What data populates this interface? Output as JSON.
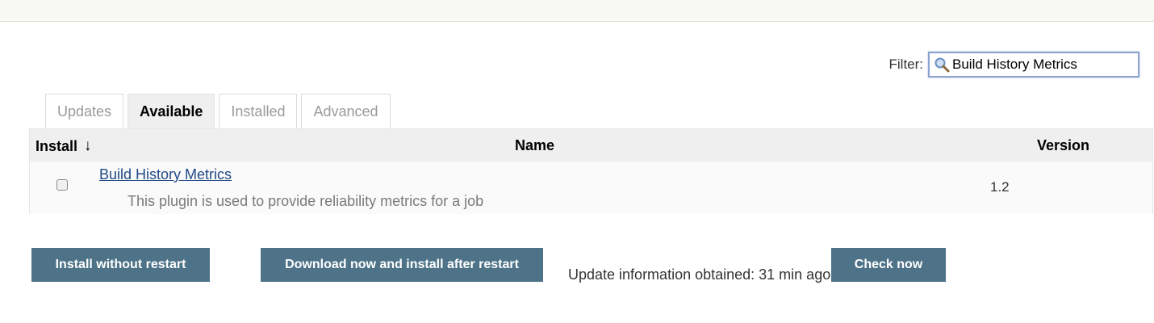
{
  "filter": {
    "label": "Filter:",
    "value": "Build History Metrics"
  },
  "tabs": [
    {
      "label": "Updates",
      "active": false
    },
    {
      "label": "Available",
      "active": true
    },
    {
      "label": "Installed",
      "active": false
    },
    {
      "label": "Advanced",
      "active": false
    }
  ],
  "table": {
    "columns": {
      "install": "Install",
      "sort_indicator": "↓",
      "name": "Name",
      "version": "Version"
    },
    "rows": [
      {
        "checked": false,
        "name": "Build History Metrics",
        "description": "This plugin is used to provide reliability metrics for a job",
        "version": "1.2"
      }
    ]
  },
  "actions": {
    "install_without_restart": "Install without restart",
    "download_and_install": "Download now and install after restart",
    "update_info": "Update information obtained: 31 min ago",
    "check_now": "Check now"
  },
  "colors": {
    "button_bg": "#4e7388",
    "link": "#204a87",
    "header_bg": "#efefef"
  },
  "icons": {
    "filter": "search-icon"
  }
}
